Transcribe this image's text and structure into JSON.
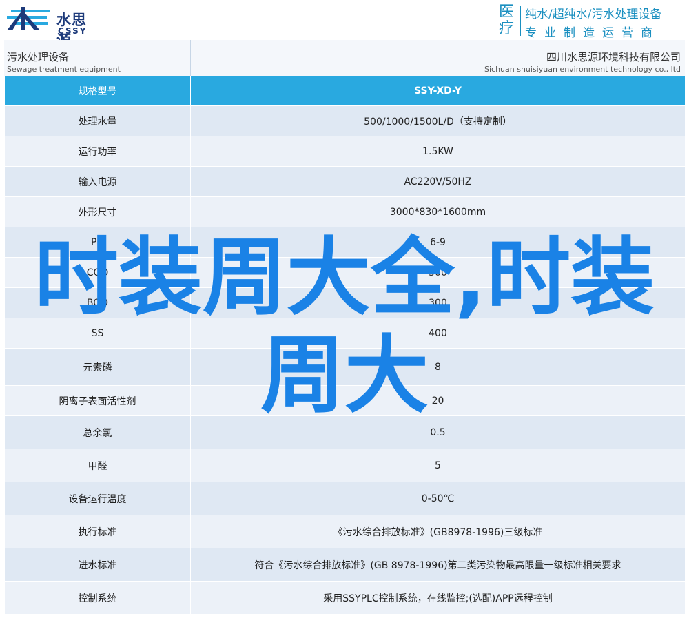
{
  "header": {
    "logo_cn": "水思源",
    "logo_en": "CSSY",
    "tag_big": "医疗",
    "tag_line1": "纯水/超纯水/污水处理设备",
    "tag_line2": "专业制造运营商"
  },
  "titlebar": {
    "left_cn": "污水处理设备",
    "left_en": "Sewage treatment equipment",
    "right_cn": "四川水思源环境科技有限公司",
    "right_en": "Sichuan shuisiyuan environment technology co., ltd"
  },
  "table": {
    "header": {
      "label": "规格型号",
      "value": "SSY-XD-Y"
    },
    "rows": [
      {
        "label": "处理水量",
        "value": "500/1000/1500L/D（支持定制）"
      },
      {
        "label": "运行功率",
        "value": "1.5KW"
      },
      {
        "label": "输入电源",
        "value": "AC220V/50HZ"
      },
      {
        "label": "外形尺寸",
        "value": "3000*830*1600mm"
      },
      {
        "label": "PH",
        "value": "6-9"
      },
      {
        "label": "COD",
        "value": "500"
      },
      {
        "label": "BOD",
        "value": "300"
      },
      {
        "label": "SS",
        "value": "400"
      },
      {
        "label": "元素磷",
        "value": "8"
      },
      {
        "label": "阴离子表面活性剂",
        "value": "20"
      },
      {
        "label": "总余氯",
        "value": "0.5"
      },
      {
        "label": "甲醛",
        "value": "5"
      },
      {
        "label": "设备运行温度",
        "value": "0-50℃"
      },
      {
        "label": "执行标准",
        "value": "《污水综合排放标准》(GB8978-1996)三级标准"
      },
      {
        "label": "进水标准",
        "value": "符合《污水综合排放标准》(GB 8978-1996)第二类污染物最高限量一级标准相关要求"
      },
      {
        "label": "控制系统",
        "value": "采用SSYPLC控制系统，在线监控;(选配)APP远程控制"
      }
    ]
  },
  "overlay_text": "时装周大全,时装周大",
  "colors": {
    "accent": "#29a9e0",
    "brand": "#1d3a7a",
    "overlay": "#1a82e6",
    "row_odd": "#dfe8f3",
    "row_even": "#ecf1f8"
  }
}
